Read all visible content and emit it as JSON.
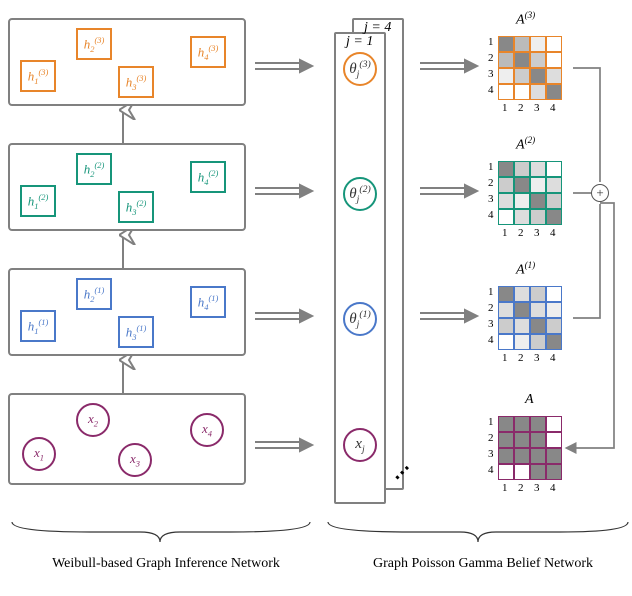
{
  "colors": {
    "orange": "#e8852a",
    "green": "#16957a",
    "blue": "#4a78c9",
    "purple": "#8a2a6a",
    "gray": "#808080"
  },
  "panels": {
    "h3": {
      "nodes": [
        "h₁⁽³⁾",
        "h₂⁽³⁾",
        "h₃⁽³⁾",
        "h₄⁽³⁾"
      ]
    },
    "h2": {
      "nodes": [
        "h₁⁽²⁾",
        "h₂⁽²⁾",
        "h₃⁽²⁾",
        "h₄⁽²⁾"
      ]
    },
    "h1": {
      "nodes": [
        "h₁⁽¹⁾",
        "h₂⁽¹⁾",
        "h₃⁽¹⁾",
        "h₄⁽¹⁾"
      ]
    },
    "x": {
      "nodes": [
        "x₁",
        "x₂",
        "x₃",
        "x₄"
      ]
    }
  },
  "middle": {
    "stack_labels": {
      "front": "j = 1",
      "back": "j = 4"
    },
    "theta": [
      "θⱼ⁽³⁾",
      "θⱼ⁽²⁾",
      "θⱼ⁽¹⁾"
    ],
    "x": "xⱼ"
  },
  "matrices": {
    "A3": "A⁽³⁾",
    "A2": "A⁽²⁾",
    "A1": "A⁽¹⁾",
    "A": "A",
    "axis": [
      "1",
      "2",
      "3",
      "4"
    ]
  },
  "captions": {
    "left": "Weibull-based Graph Inference Network",
    "right": "Graph Poisson Gamma Belief Network"
  },
  "chart_data": {
    "type": "diagram",
    "description": "Architecture diagram with two labeled components connected by double arrows.",
    "left_component": {
      "name": "Weibull-based Graph Inference Network",
      "layers": [
        {
          "level": 3,
          "color": "orange",
          "nodes": [
            "h1(3)",
            "h2(3)",
            "h3(3)",
            "h4(3)"
          ],
          "shape": "square"
        },
        {
          "level": 2,
          "color": "green",
          "nodes": [
            "h1(2)",
            "h2(2)",
            "h3(2)",
            "h4(2)"
          ],
          "shape": "square"
        },
        {
          "level": 1,
          "color": "blue",
          "nodes": [
            "h1(1)",
            "h2(1)",
            "h3(1)",
            "h4(1)"
          ],
          "shape": "square"
        },
        {
          "level": 0,
          "color": "purple",
          "nodes": [
            "x1",
            "x2",
            "x3",
            "x4"
          ],
          "shape": "circle"
        }
      ],
      "intra_layer_edges": [
        [
          1,
          2
        ],
        [
          1,
          3
        ],
        [
          2,
          3
        ],
        [
          3,
          4
        ]
      ],
      "inter_layer_arrows": "upward open arrows between consecutive layers"
    },
    "right_component": {
      "name": "Graph Poisson Gamma Belief Network",
      "stacked_over_j": {
        "front": 1,
        "back": 4
      },
      "chain": [
        "theta_j(3)",
        "theta_j(2)",
        "theta_j(1)",
        "x_j"
      ],
      "chain_edge_colors": [
        "orange",
        "green",
        "blue"
      ],
      "adjacency_matrices": [
        "A(3)",
        "A(2)",
        "A(1)",
        "A"
      ],
      "aggregation": "A(3) ⊕ A(2) ⊕ A(1) → A"
    }
  }
}
